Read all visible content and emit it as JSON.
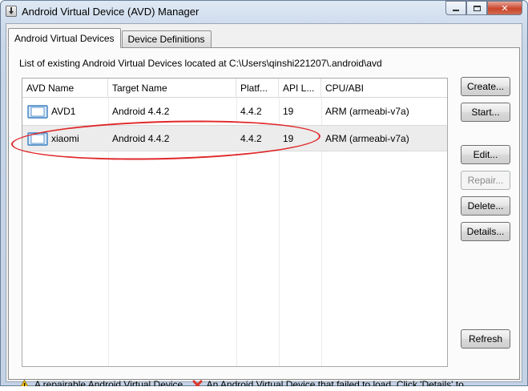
{
  "window": {
    "title": "Android Virtual Device (AVD) Manager",
    "controls": {
      "minimize": "minimize",
      "maximize": "maximize",
      "close": "✕"
    }
  },
  "tabs": [
    {
      "label": "Android Virtual Devices",
      "active": true
    },
    {
      "label": "Device Definitions",
      "active": false
    }
  ],
  "list_label": "List of existing Android Virtual Devices located at C:\\Users\\qinshi221207\\.android\\avd",
  "table": {
    "columns": [
      "AVD Name",
      "Target Name",
      "Platf...",
      "API L...",
      "CPU/ABI"
    ],
    "rows": [
      {
        "name": "AVD1",
        "target": "Android 4.4.2",
        "platform": "4.4.2",
        "api": "19",
        "cpu": "ARM (armeabi-v7a)",
        "icon": "device-icon"
      },
      {
        "name": "xiaomi",
        "target": "Android 4.4.2",
        "platform": "4.4.2",
        "api": "19",
        "cpu": "ARM (armeabi-v7a)",
        "icon": "device-icon",
        "selected": true
      }
    ]
  },
  "buttons": {
    "create": "Create...",
    "start": "Start...",
    "edit": "Edit...",
    "repair": "Repair...",
    "delete": "Delete...",
    "details": "Details...",
    "refresh": "Refresh"
  },
  "legend": {
    "warning_text": "A repairable Android Virtual Device.",
    "error_text": "An Android Virtual Device that failed to load. Click 'Details' to"
  },
  "colors": {
    "annotation": "#e0282a",
    "selection": "#ececec"
  }
}
